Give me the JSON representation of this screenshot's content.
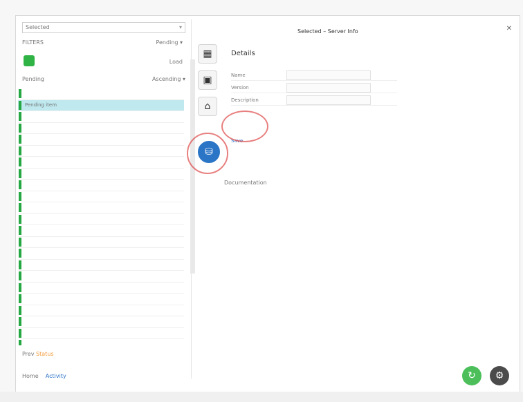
{
  "left": {
    "dropdown": {
      "label": "Selected",
      "arrow": "▾"
    },
    "row1": {
      "left": "FILTERS",
      "right": "Pending  ▾"
    },
    "row2": {
      "right": "Load"
    },
    "tabs": {
      "left": "Pending",
      "right": "Ascending  ▾"
    },
    "items": [
      {
        "label": "",
        "value": "",
        "highlight": false
      },
      {
        "label": "Pending item",
        "value": "",
        "highlight": true
      },
      {
        "label": "",
        "value": "",
        "highlight": false
      },
      {
        "label": "",
        "value": "",
        "highlight": false
      },
      {
        "label": "",
        "value": "",
        "highlight": false
      },
      {
        "label": "",
        "value": "",
        "highlight": false
      },
      {
        "label": "",
        "value": "",
        "highlight": false
      },
      {
        "label": "",
        "value": "",
        "highlight": false
      },
      {
        "label": "",
        "value": "",
        "highlight": false
      },
      {
        "label": "",
        "value": "",
        "highlight": false
      },
      {
        "label": "",
        "value": "",
        "highlight": false
      },
      {
        "label": "",
        "value": "",
        "highlight": false
      },
      {
        "label": "",
        "value": "",
        "highlight": false
      },
      {
        "label": "",
        "value": "",
        "highlight": false
      },
      {
        "label": "",
        "value": "",
        "highlight": false
      },
      {
        "label": "",
        "value": "",
        "highlight": false
      },
      {
        "label": "",
        "value": "",
        "highlight": false
      },
      {
        "label": "",
        "value": "",
        "highlight": false
      },
      {
        "label": "",
        "value": "",
        "highlight": false
      },
      {
        "label": "",
        "value": "",
        "highlight": false
      },
      {
        "label": "",
        "value": "",
        "highlight": false
      },
      {
        "label": "",
        "value": "",
        "highlight": false
      },
      {
        "label": "",
        "value": "",
        "highlight": false
      },
      {
        "label": "",
        "value": "",
        "highlight": false
      }
    ],
    "status": {
      "prefix": "Prev",
      "orange": "Status",
      "suffix": ""
    },
    "bottom_tabs": {
      "a": "Home",
      "b": "Activity"
    }
  },
  "mid": {
    "icons": [
      {
        "name": "files-icon",
        "glyph": "▦"
      },
      {
        "name": "image-icon",
        "glyph": "▣"
      },
      {
        "name": "home-icon",
        "glyph": "⌂"
      },
      {
        "name": "db-icon",
        "glyph": "⛁"
      }
    ]
  },
  "header": {
    "title": "Selected – Server Info",
    "close": "✕"
  },
  "panel": {
    "title": "Details",
    "fields": [
      "Name",
      "Version",
      "Description"
    ],
    "link": "Save"
  },
  "warning": "Documentation",
  "fabs": {
    "green": "↻",
    "dark": "⚙"
  },
  "colors": {
    "accent": "#2b75c6",
    "green": "#25a744",
    "highlight": "#bfe9ef"
  }
}
